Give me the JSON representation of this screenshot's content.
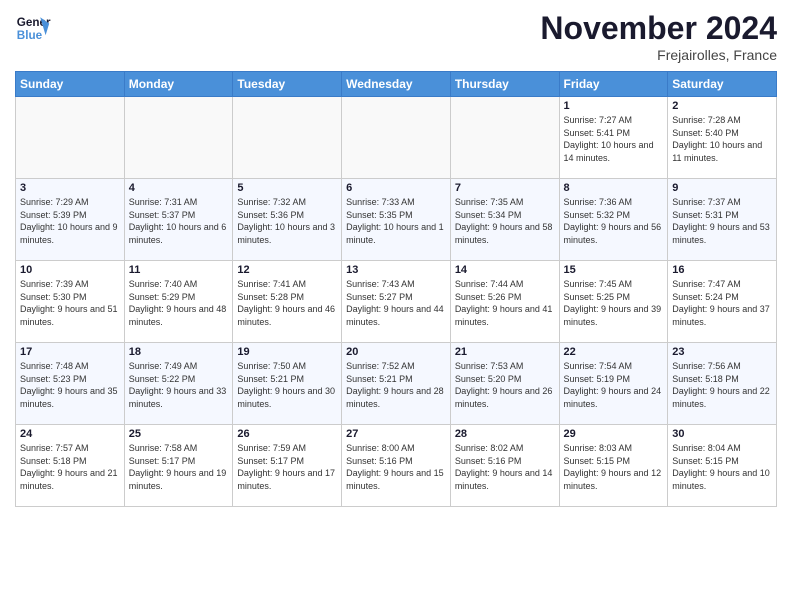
{
  "logo": {
    "text_general": "General",
    "text_blue": "Blue"
  },
  "header": {
    "month": "November 2024",
    "location": "Frejairolles, France"
  },
  "weekdays": [
    "Sunday",
    "Monday",
    "Tuesday",
    "Wednesday",
    "Thursday",
    "Friday",
    "Saturday"
  ],
  "weeks": [
    [
      {
        "day": "",
        "info": ""
      },
      {
        "day": "",
        "info": ""
      },
      {
        "day": "",
        "info": ""
      },
      {
        "day": "",
        "info": ""
      },
      {
        "day": "",
        "info": ""
      },
      {
        "day": "1",
        "info": "Sunrise: 7:27 AM\nSunset: 5:41 PM\nDaylight: 10 hours and 14 minutes."
      },
      {
        "day": "2",
        "info": "Sunrise: 7:28 AM\nSunset: 5:40 PM\nDaylight: 10 hours and 11 minutes."
      }
    ],
    [
      {
        "day": "3",
        "info": "Sunrise: 7:29 AM\nSunset: 5:39 PM\nDaylight: 10 hours and 9 minutes."
      },
      {
        "day": "4",
        "info": "Sunrise: 7:31 AM\nSunset: 5:37 PM\nDaylight: 10 hours and 6 minutes."
      },
      {
        "day": "5",
        "info": "Sunrise: 7:32 AM\nSunset: 5:36 PM\nDaylight: 10 hours and 3 minutes."
      },
      {
        "day": "6",
        "info": "Sunrise: 7:33 AM\nSunset: 5:35 PM\nDaylight: 10 hours and 1 minute."
      },
      {
        "day": "7",
        "info": "Sunrise: 7:35 AM\nSunset: 5:34 PM\nDaylight: 9 hours and 58 minutes."
      },
      {
        "day": "8",
        "info": "Sunrise: 7:36 AM\nSunset: 5:32 PM\nDaylight: 9 hours and 56 minutes."
      },
      {
        "day": "9",
        "info": "Sunrise: 7:37 AM\nSunset: 5:31 PM\nDaylight: 9 hours and 53 minutes."
      }
    ],
    [
      {
        "day": "10",
        "info": "Sunrise: 7:39 AM\nSunset: 5:30 PM\nDaylight: 9 hours and 51 minutes."
      },
      {
        "day": "11",
        "info": "Sunrise: 7:40 AM\nSunset: 5:29 PM\nDaylight: 9 hours and 48 minutes."
      },
      {
        "day": "12",
        "info": "Sunrise: 7:41 AM\nSunset: 5:28 PM\nDaylight: 9 hours and 46 minutes."
      },
      {
        "day": "13",
        "info": "Sunrise: 7:43 AM\nSunset: 5:27 PM\nDaylight: 9 hours and 44 minutes."
      },
      {
        "day": "14",
        "info": "Sunrise: 7:44 AM\nSunset: 5:26 PM\nDaylight: 9 hours and 41 minutes."
      },
      {
        "day": "15",
        "info": "Sunrise: 7:45 AM\nSunset: 5:25 PM\nDaylight: 9 hours and 39 minutes."
      },
      {
        "day": "16",
        "info": "Sunrise: 7:47 AM\nSunset: 5:24 PM\nDaylight: 9 hours and 37 minutes."
      }
    ],
    [
      {
        "day": "17",
        "info": "Sunrise: 7:48 AM\nSunset: 5:23 PM\nDaylight: 9 hours and 35 minutes."
      },
      {
        "day": "18",
        "info": "Sunrise: 7:49 AM\nSunset: 5:22 PM\nDaylight: 9 hours and 33 minutes."
      },
      {
        "day": "19",
        "info": "Sunrise: 7:50 AM\nSunset: 5:21 PM\nDaylight: 9 hours and 30 minutes."
      },
      {
        "day": "20",
        "info": "Sunrise: 7:52 AM\nSunset: 5:21 PM\nDaylight: 9 hours and 28 minutes."
      },
      {
        "day": "21",
        "info": "Sunrise: 7:53 AM\nSunset: 5:20 PM\nDaylight: 9 hours and 26 minutes."
      },
      {
        "day": "22",
        "info": "Sunrise: 7:54 AM\nSunset: 5:19 PM\nDaylight: 9 hours and 24 minutes."
      },
      {
        "day": "23",
        "info": "Sunrise: 7:56 AM\nSunset: 5:18 PM\nDaylight: 9 hours and 22 minutes."
      }
    ],
    [
      {
        "day": "24",
        "info": "Sunrise: 7:57 AM\nSunset: 5:18 PM\nDaylight: 9 hours and 21 minutes."
      },
      {
        "day": "25",
        "info": "Sunrise: 7:58 AM\nSunset: 5:17 PM\nDaylight: 9 hours and 19 minutes."
      },
      {
        "day": "26",
        "info": "Sunrise: 7:59 AM\nSunset: 5:17 PM\nDaylight: 9 hours and 17 minutes."
      },
      {
        "day": "27",
        "info": "Sunrise: 8:00 AM\nSunset: 5:16 PM\nDaylight: 9 hours and 15 minutes."
      },
      {
        "day": "28",
        "info": "Sunrise: 8:02 AM\nSunset: 5:16 PM\nDaylight: 9 hours and 14 minutes."
      },
      {
        "day": "29",
        "info": "Sunrise: 8:03 AM\nSunset: 5:15 PM\nDaylight: 9 hours and 12 minutes."
      },
      {
        "day": "30",
        "info": "Sunrise: 8:04 AM\nSunset: 5:15 PM\nDaylight: 9 hours and 10 minutes."
      }
    ]
  ]
}
